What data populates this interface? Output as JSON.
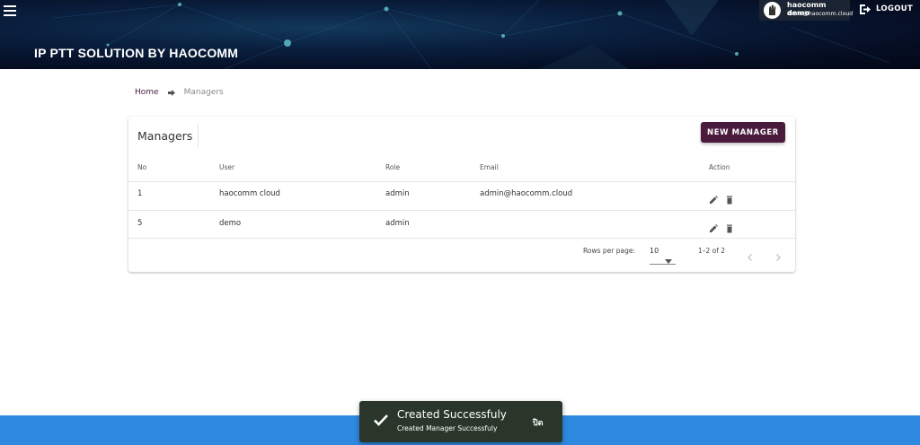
{
  "header": {
    "title": "IP PTT SOLUTION BY HAOCOMM",
    "user_name": "haocomm demo",
    "user_email": "demo@haocomm.cloud",
    "logout_label": "LOGOUT"
  },
  "breadcrumb": {
    "home": "Home",
    "current": "Managers"
  },
  "managers": {
    "title": "Managers",
    "new_button": "NEW MANAGER",
    "columns": [
      "No",
      "User",
      "Role",
      "Email",
      "Action"
    ],
    "rows": [
      {
        "no": "1",
        "user": "haocomm cloud",
        "role": "admin",
        "email": "admin@haocomm.cloud"
      },
      {
        "no": "5",
        "user": "demo",
        "role": "admin",
        "email": ""
      }
    ],
    "pagination": {
      "rows_per_page_label": "Rows per page:",
      "rows_per_page_value": "10",
      "range": "1–2 of 2"
    }
  },
  "toast": {
    "title": "Created Successfuly",
    "message": "Created Manager Successfuly",
    "close_label": "ปิด"
  },
  "colors": {
    "primary": "#4a1b3d",
    "bottom_bar": "#2d8ae0",
    "toast_bg": "#2a3629"
  }
}
